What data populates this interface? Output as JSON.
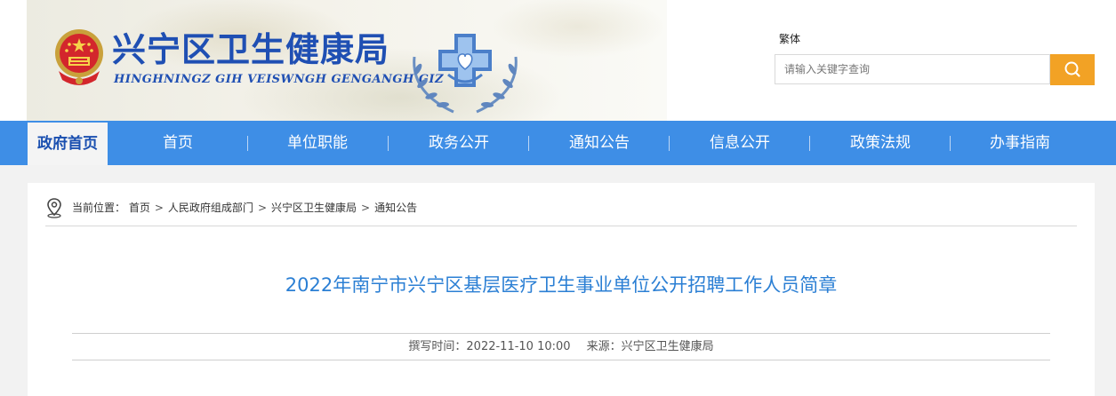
{
  "header": {
    "site_title": "兴宁区卫生健康局",
    "site_subtitle": "HINGHNINGZ GIH VEISWNGH GENGANGH GIZ",
    "lang_toggle": "繁体",
    "search": {
      "placeholder": "请输入关键字查询",
      "value": "",
      "button_icon": "search-icon"
    },
    "icons": {
      "emblem": "national-emblem-icon",
      "health_logo": "health-cross-logo-icon"
    }
  },
  "nav": {
    "home_label": "政府首页",
    "items": [
      {
        "label": "首页"
      },
      {
        "label": "单位职能"
      },
      {
        "label": "政务公开"
      },
      {
        "label": "通知公告"
      },
      {
        "label": "信息公开"
      },
      {
        "label": "政策法规"
      },
      {
        "label": "办事指南"
      }
    ]
  },
  "breadcrumb": {
    "icon": "location-pin-icon",
    "prefix": "当前位置：",
    "items": [
      "首页",
      "人民政府组成部门",
      "兴宁区卫生健康局",
      "通知公告"
    ],
    "separator": ">"
  },
  "article": {
    "title": "2022年南宁市兴宁区基层医疗卫生事业单位公开招聘工作人员简章",
    "meta": {
      "date_label": "撰写时间：",
      "date_value": "2022-11-10 10:00",
      "source_label": "来源：",
      "source_value": "兴宁区卫生健康局"
    }
  },
  "colors": {
    "nav_bg": "#3e8ee6",
    "brand_blue": "#1f4fb3",
    "title_blue": "#2b7fd4",
    "search_button": "#f2a225",
    "page_bg": "#f2f2f2"
  }
}
